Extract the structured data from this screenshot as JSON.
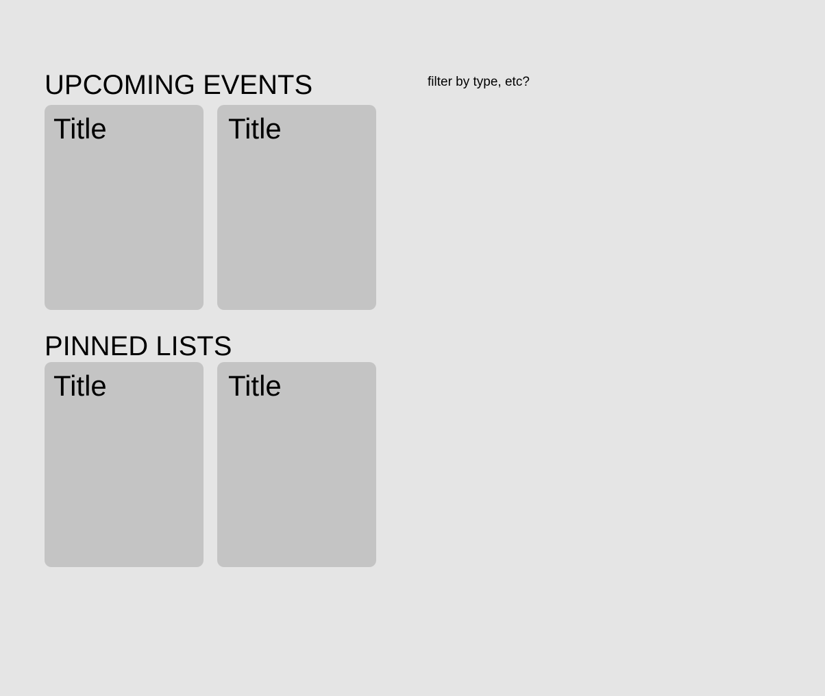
{
  "upcoming_events": {
    "heading": "UPCOMING EVENTS",
    "cards": [
      {
        "title": "Title"
      },
      {
        "title": "Title"
      }
    ]
  },
  "pinned_lists": {
    "heading": "PINNED LISTS",
    "cards": [
      {
        "title": "Title"
      },
      {
        "title": "Title"
      }
    ]
  },
  "filter_note": "filter by type, etc?",
  "colors": {
    "background": "#e5e5e5",
    "card": "#c4c4c4",
    "text": "#000000"
  }
}
